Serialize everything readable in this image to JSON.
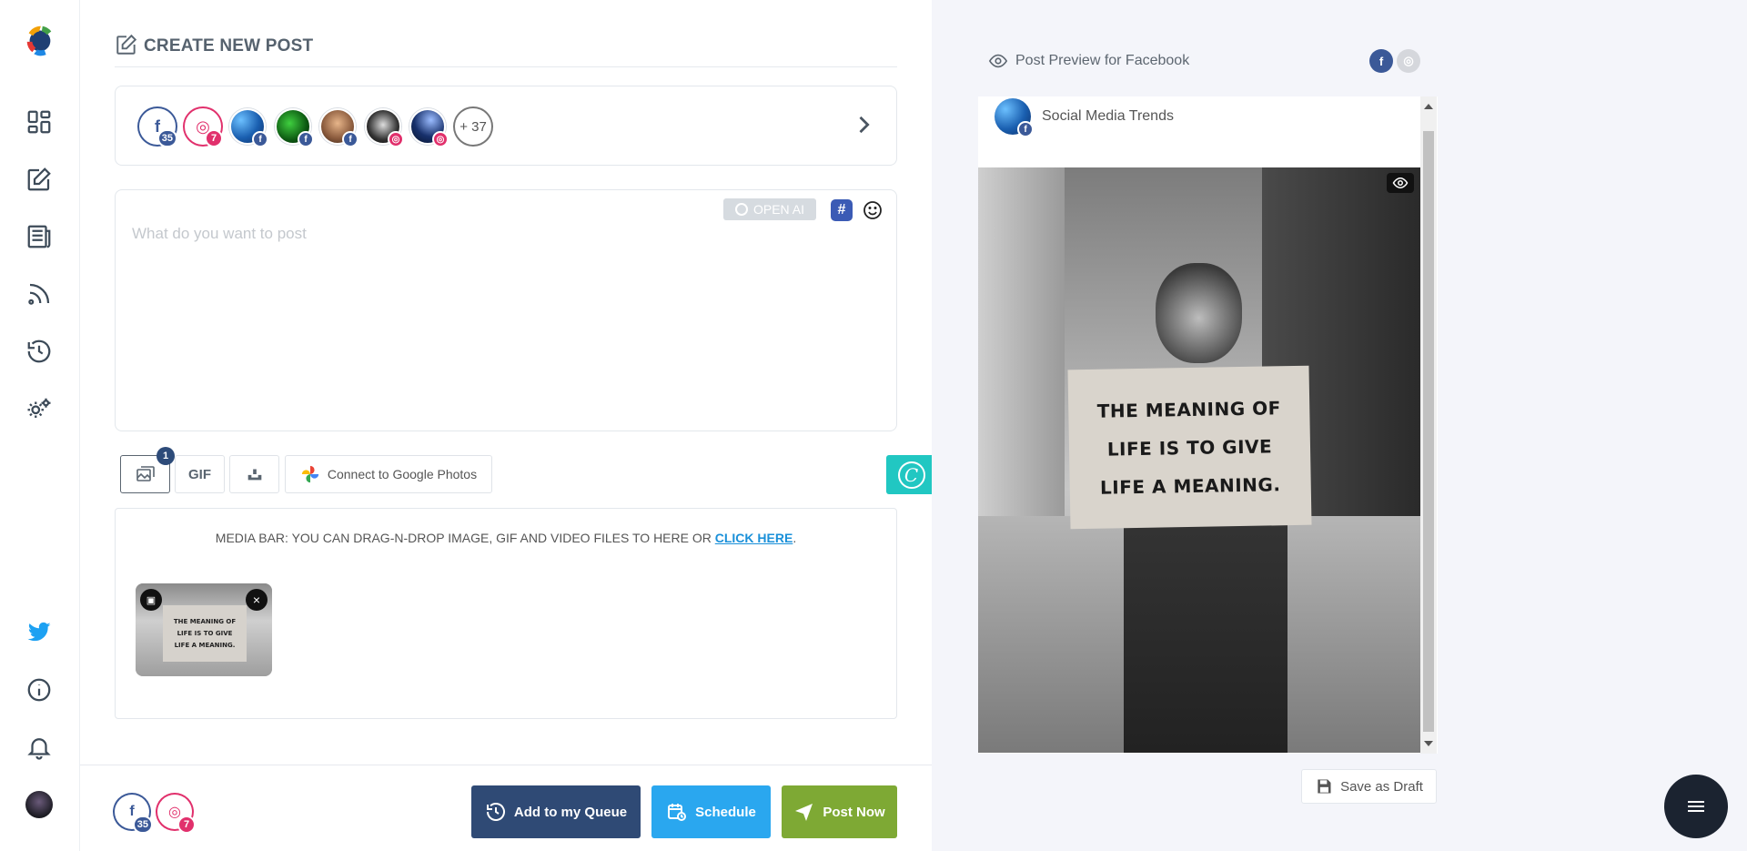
{
  "composer": {
    "title": "CREATE NEW POST",
    "accounts": [
      {
        "network": "facebook",
        "glyph": "f",
        "count": "35"
      },
      {
        "network": "instagram",
        "glyph": "◎",
        "count": "7"
      }
    ],
    "more_accounts": "+ 37",
    "editor_placeholder": "What do you want to post",
    "openai_label": "OPEN AI",
    "hashtag_glyph": "#",
    "media_toolbar": {
      "image_count": "1",
      "gif_label": "GIF",
      "google_photos_label": "Connect to Google Photos",
      "canva_glyph": "C"
    },
    "media_bar": {
      "text": "MEDIA BAR: YOU CAN DRAG-N-DROP IMAGE, GIF AND VIDEO FILES TO HERE OR ",
      "link": "CLICK HERE",
      "suffix": "."
    },
    "thumbnail_sign": [
      "THE MEANING OF",
      "LIFE IS TO GIVE",
      "LIFE A MEANING."
    ]
  },
  "footer": {
    "fb_count": "35",
    "ig_count": "7",
    "queue_label": "Add to my Queue",
    "schedule_label": "Schedule",
    "post_label": "Post Now"
  },
  "preview": {
    "title": "Post Preview for Facebook",
    "page_name": "Social Media Trends",
    "sign_lines": [
      "THE MEANING OF",
      "LIFE IS TO GIVE",
      "LIFE A MEANING."
    ],
    "save_draft_label": "Save as Draft"
  },
  "colors": {
    "facebook": "#3b5998",
    "instagram": "#e1306c",
    "queue": "#2f4a75",
    "schedule": "#2aa7ef",
    "post_now": "#7ea934",
    "canva": "#21c7c2"
  }
}
